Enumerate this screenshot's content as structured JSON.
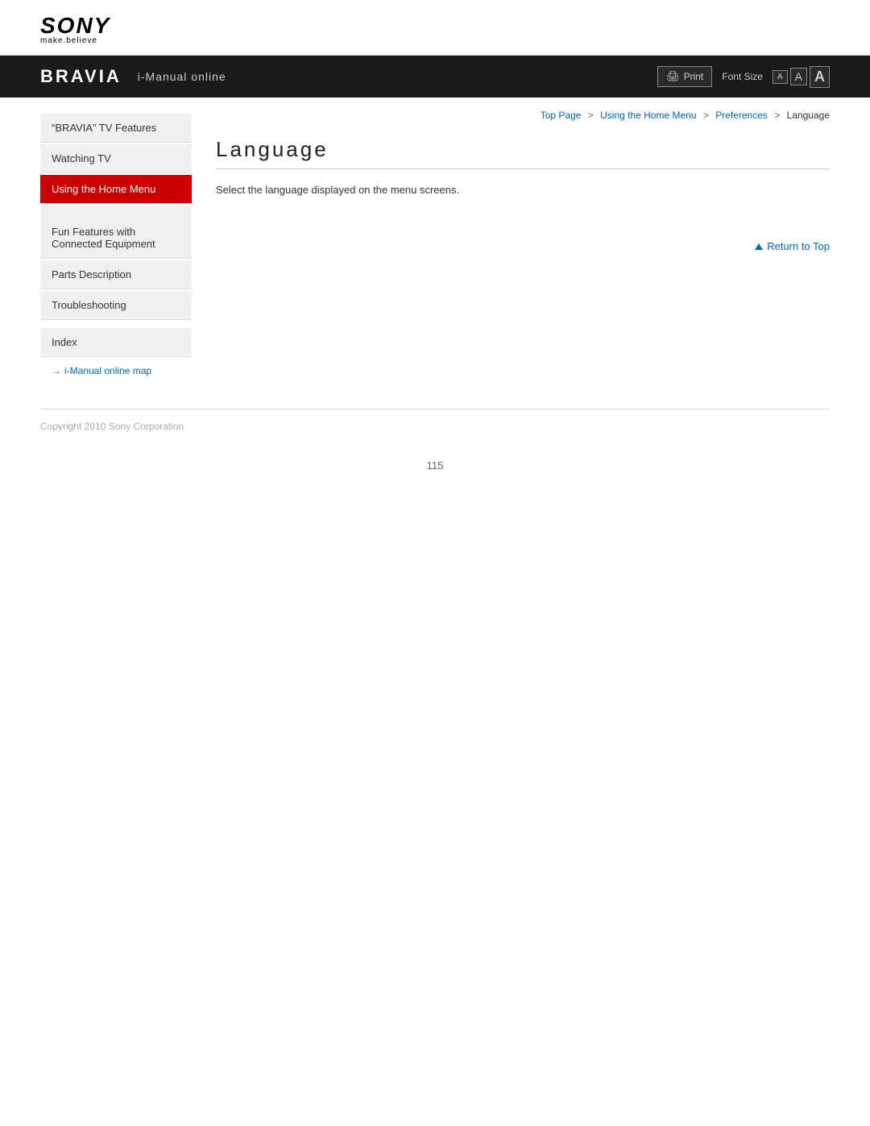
{
  "header": {
    "sony_text": "SONY",
    "tagline": "make.believe",
    "bravia_logo": "BRAVIA",
    "imanual": "i-Manual online",
    "print_label": "Print",
    "font_size_label": "Font Size",
    "font_small": "A",
    "font_medium": "A",
    "font_large": "A"
  },
  "breadcrumb": {
    "top_page": "Top Page",
    "separator1": ">",
    "using_home_menu": "Using the Home Menu",
    "separator2": ">",
    "preferences": "Preferences",
    "separator3": ">",
    "current": "Language"
  },
  "sidebar": {
    "items": [
      {
        "id": "bravia-features",
        "label": "“BRAVIA” TV Features",
        "active": false
      },
      {
        "id": "watching-tv",
        "label": "Watching TV",
        "active": false
      },
      {
        "id": "using-home-menu",
        "label": "Using the Home Menu",
        "active": true
      },
      {
        "id": "fun-features",
        "label": "Fun Features with\nConnected Equipment",
        "active": false
      },
      {
        "id": "parts-description",
        "label": "Parts Description",
        "active": false
      },
      {
        "id": "troubleshooting",
        "label": "Troubleshooting",
        "active": false
      }
    ],
    "index_label": "Index",
    "map_link": "i-Manual online map"
  },
  "content": {
    "title": "Language",
    "description": "Select the language displayed on the menu screens."
  },
  "return_to_top": "Return to Top",
  "footer": {
    "copyright": "Copyright 2010 Sony Corporation",
    "page_number": "115"
  }
}
